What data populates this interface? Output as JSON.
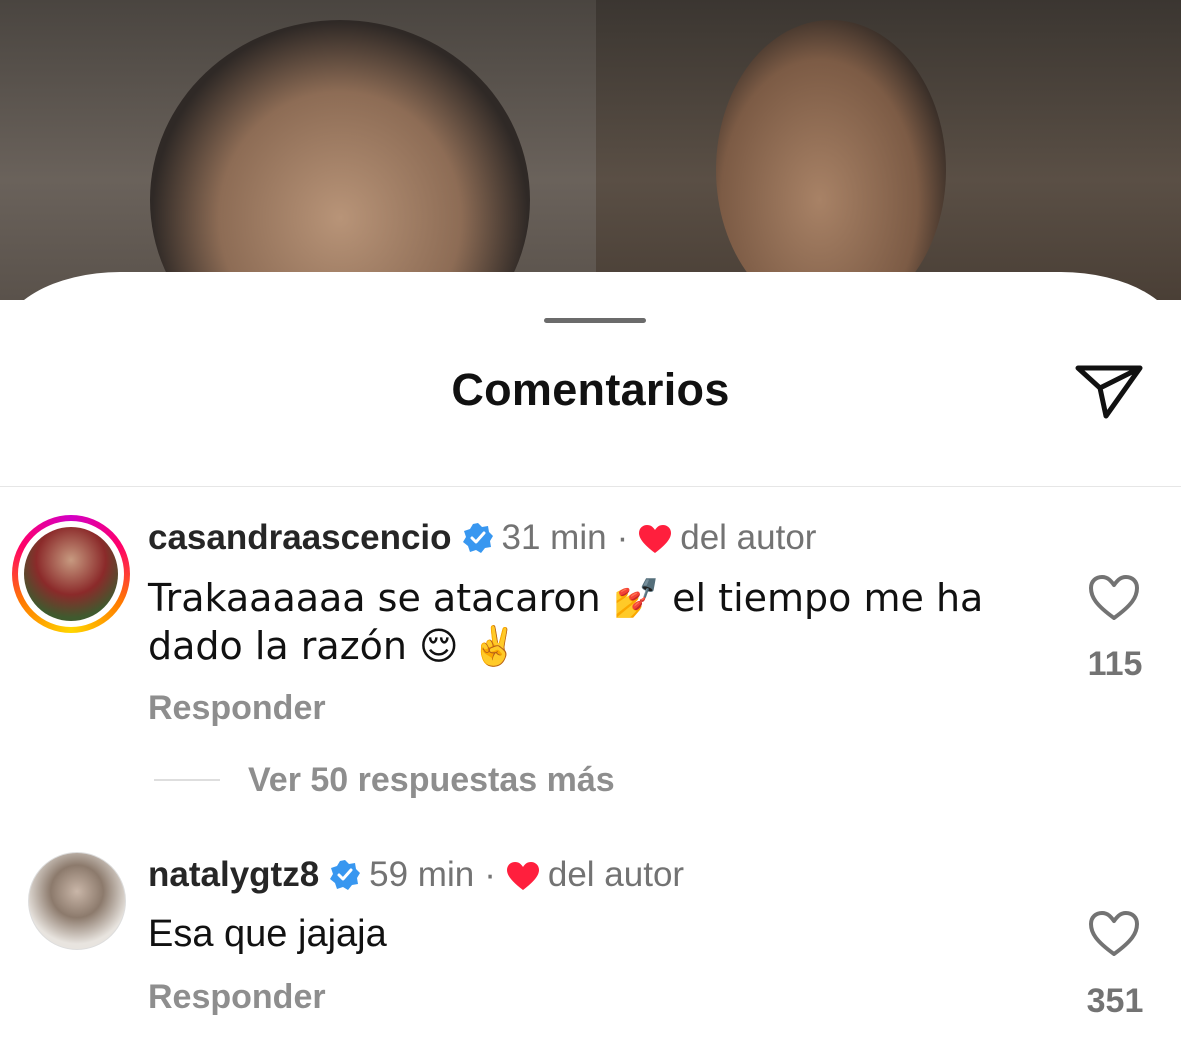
{
  "header": {
    "title": "Comentarios"
  },
  "comments": [
    {
      "username": "casandraascencio",
      "time": "31 min",
      "separator": "·",
      "author_like": "del autor",
      "text_line1": "Trakaaaaaa se atacaron 💅 el tiempo me ha",
      "text_line2": "dado la razón 😌 ✌️",
      "reply_label": "Responder",
      "likes": "115",
      "more_replies": "Ver 50 respuestas más",
      "has_story_ring": true
    },
    {
      "username": "natalygtz8",
      "time": "59 min",
      "separator": "·",
      "author_like": "del autor",
      "text_line1": "Esa que jajaja",
      "reply_label": "Responder",
      "likes": "351",
      "has_story_ring": false
    }
  ],
  "colors": {
    "verified": "#3897f0",
    "heart": "#ff1f3d",
    "muted": "#737373"
  },
  "icons": [
    "share-icon",
    "verified-icon",
    "heart-icon",
    "like-heart-outline-icon"
  ]
}
